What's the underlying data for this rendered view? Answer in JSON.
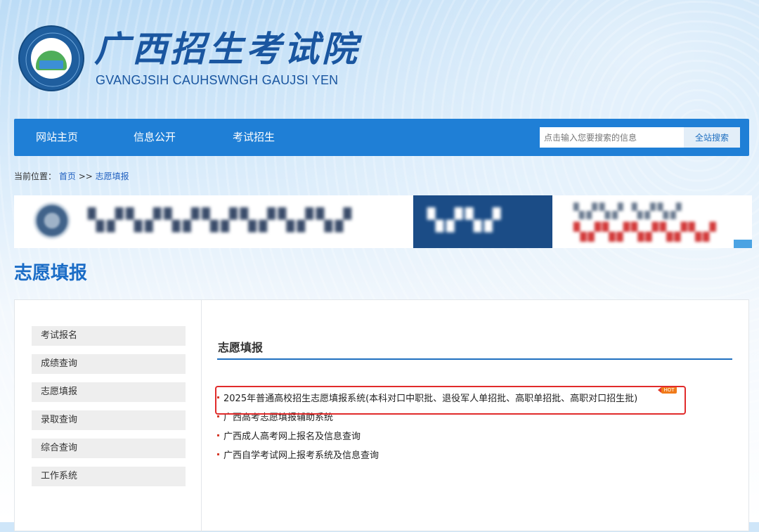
{
  "header": {
    "site_title": "广西招生考试院",
    "site_subtitle": "GVANGJSIH CAUHSWNGH GAUJSI YEN",
    "logo_ring_text": "广西招生考试院 GVANGJSIH CAUHSWNGH GAUJSI YEN"
  },
  "nav": {
    "items": [
      "网站主页",
      "信息公开",
      "考试招生"
    ],
    "search_placeholder": "点击输入您要搜索的信息",
    "search_button": "全站搜索"
  },
  "breadcrumb": {
    "prefix": "当前位置：",
    "home": "首页",
    "separator": ">>",
    "current": "志愿填报"
  },
  "page_title": "志愿填报",
  "sidebar": {
    "items": [
      "考试报名",
      "成绩查询",
      "志愿填报",
      "录取查询",
      "综合查询",
      "工作系统"
    ]
  },
  "main": {
    "section_title": "志愿填报",
    "links": [
      "2025年普通高校招生志愿填报系统(本科对口中职批、退役军人单招批、高职单招批、高职对口招生批)",
      "广西高考志愿填报辅助系统",
      "广西成人高考网上报名及信息查询",
      "广西自学考试网上报考系统及信息查询"
    ],
    "hot_label": "HOT"
  },
  "colors": {
    "nav_bg": "#1f7fd6",
    "title_blue": "#1a56a0",
    "heading_blue": "#1a6cc6",
    "highlight_red": "#e12b2b",
    "hot_orange": "#f07b1a"
  }
}
